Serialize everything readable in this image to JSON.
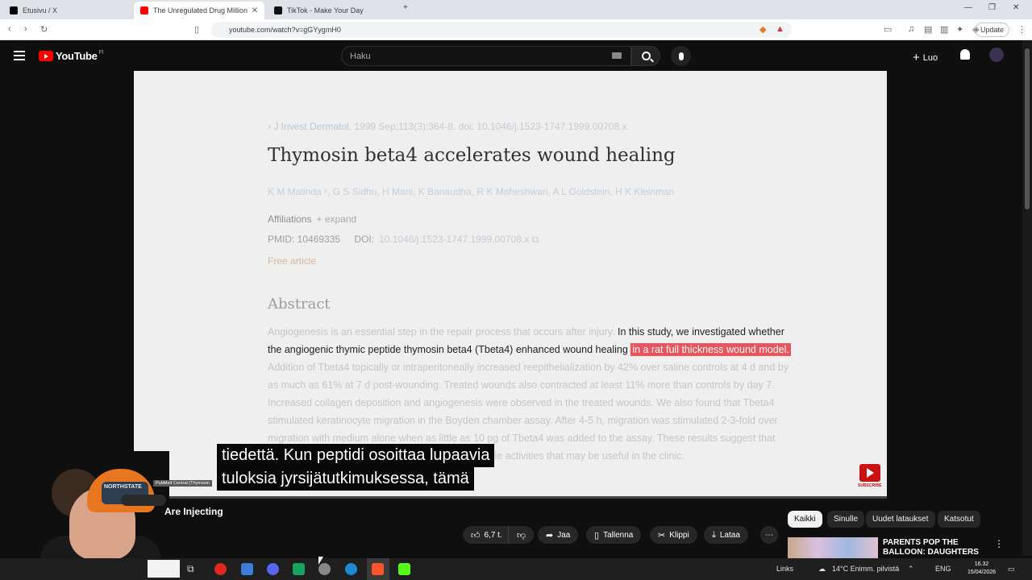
{
  "browser": {
    "tabs": [
      {
        "label": "Etusivu / X",
        "active": false
      },
      {
        "label": "The Unregulated Drug Million",
        "active": true
      },
      {
        "label": "TikTok - Make Your Day",
        "active": false
      }
    ],
    "url": "youtube.com/watch?v=gGYygmH0",
    "update_label": "Update"
  },
  "youtube": {
    "logo_text": "YouTube",
    "region": "FI",
    "search_placeholder": "Haku",
    "create_label": "Luo"
  },
  "paper": {
    "citation_journal": "J Invest Dermatol",
    "citation_rest": ". 1999 Sep;113(3):364-8. doi: 10.1046/j.1523-1747.1999.00708.x.",
    "title": "Thymosin beta4 accelerates wound healing",
    "authors": "K M Malinda ¹, G S Sidhu, H Mani, K Banaudha, R K Maheshwari, A L Goldstein, H K Kleinman",
    "affiliations_label": "Affiliations",
    "expand_label": "+ expand",
    "pmid_label": "PMID: 10469335",
    "doi_label": "DOI:",
    "doi_value": "10.1046/j.1523-1747.1999.00708.x",
    "free_label": "Free article",
    "abstract_heading": "Abstract",
    "abstract_faded_1": "Angiogenesis is an essential step in the repair process that occurs after injury. ",
    "abstract_strong": "In this study, we investigated whether the angiogenic thymic peptide thymosin beta4 (Tbeta4) enhanced wound healing",
    "abstract_highlight": "in a rat full thickness wound model.",
    "abstract_faded_2": " Addition of Tbeta4 topically or intraperitoneally increased reepithelialization by 42% over saline controls at 4 d and by as much as 61% at 7 d post-wounding. Treated wounds also contracted at least 11% more than controls by day 7. Increased collagen deposition and angiogenesis were observed in the treated wounds. We also found that Tbeta4 stimulated keratinocyte migration in the Boyden chamber assay. After 4-5 h, migration was stimulated 2-3-fold over migration with medium alone when as little as 10 pg of Tbeta4 was added to the assay. These results suggest that Tbeta4 is a potent wound healing factor with multiple activities that may be useful in the clinic."
  },
  "video": {
    "pmc_tag": "PubMed Central (Thymosin",
    "subtitle_line1": "tiedettä.  Kun peptidi osoittaa lupaavia",
    "subtitle_line2": "tuloksia jyrsijätutkimuksessa, tämä",
    "title_fragment": "Are Injecting",
    "progress_fraction": 0.0,
    "subscribe_label": "SUBSCRIBE"
  },
  "actions": {
    "likes": "6,7 t.",
    "share": "Jaa",
    "save": "Tallenna",
    "clip": "Klippi",
    "download": "Lataa"
  },
  "chips": [
    "Kaikki",
    "Sinulle",
    "Uudet lataukset",
    "Katsotut"
  ],
  "recommendation": {
    "title": "PARENTS POP THE BALLOON: DAUGHTERS EDITION"
  },
  "webcam": {
    "hat_text": "NORTHSTATE"
  },
  "taskbar": {
    "links": "Links",
    "weather": "14°C  Enimm. pilvistä",
    "lang": "ENG",
    "time": "16.32",
    "date": "15/04/2026"
  }
}
